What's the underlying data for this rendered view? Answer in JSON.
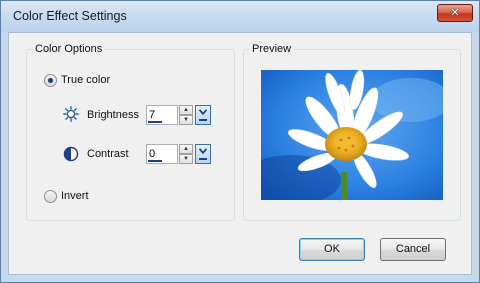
{
  "window": {
    "title": "Color Effect Settings"
  },
  "color_options": {
    "legend": "Color Options",
    "true_color": {
      "label": "True color",
      "checked": true
    },
    "brightness": {
      "label": "Brightness",
      "value": "7",
      "icon": "sun-icon"
    },
    "contrast": {
      "label": "Contrast",
      "value": "0",
      "icon": "contrast-icon"
    },
    "invert": {
      "label": "Invert",
      "checked": false
    }
  },
  "preview": {
    "legend": "Preview",
    "image": "daisy-flower-photo"
  },
  "buttons": {
    "ok": "OK",
    "cancel": "Cancel"
  },
  "colors": {
    "title_bar": "#c9dcf1",
    "close_button": "#c2361d",
    "dialog_body": "#f0f0f0",
    "accent": "#1e3f8c",
    "preview_sky": "#1e6fd9"
  }
}
